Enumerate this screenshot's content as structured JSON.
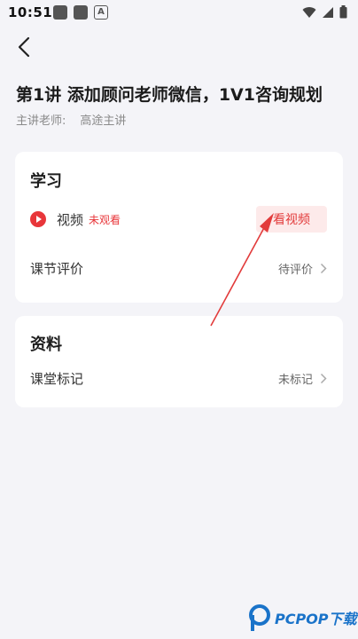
{
  "status_bar": {
    "time": "10:51",
    "letter": "A"
  },
  "page": {
    "title": "第1讲 添加顾问老师微信，1V1咨询规划",
    "teacher_label": "主讲老师:",
    "teacher_value": "高途主讲"
  },
  "study": {
    "title": "学习",
    "video_label": "视频",
    "video_status": "未观看",
    "watch_button": "看视频",
    "eval_label": "课节评价",
    "eval_status": "待评价"
  },
  "material": {
    "title": "资料",
    "mark_label": "课堂标记",
    "mark_status": "未标记"
  },
  "watermark": {
    "text": "PCPOP下载"
  },
  "colors": {
    "accent": "#e8363a",
    "annotation": "#e23b3b",
    "background": "#f4f4f8"
  }
}
